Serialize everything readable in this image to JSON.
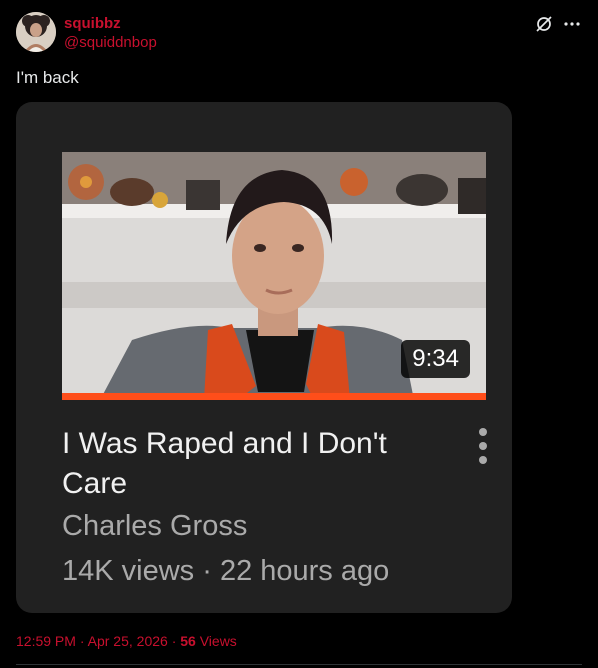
{
  "post": {
    "display_name": "squibbz",
    "handle": "@squiddnbop",
    "text": "I'm back",
    "header_icons": [
      "grok-icon",
      "more-icon"
    ],
    "footer": {
      "time": "12:59 PM",
      "separator": "·",
      "date": "Apr 25, 2026",
      "views_count": "56",
      "views_label": "Views"
    }
  },
  "embedded_card": {
    "duration": "9:34",
    "title": "I Was Raped and I Don't Care",
    "channel": "Charles Gross",
    "meta": "14K views · 22 hours ago",
    "progress_fraction": 1.0
  },
  "colors": {
    "accent_text": "#c8102e",
    "progress_bar": "#ff4e1a",
    "card_bg": "#212121"
  }
}
